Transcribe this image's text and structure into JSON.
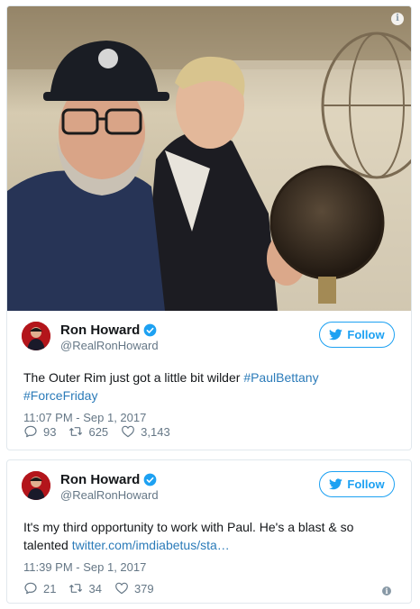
{
  "photo": {
    "info_glyph": "i"
  },
  "tweets": [
    {
      "author": {
        "name": "Ron Howard",
        "handle": "@RealRonHoward"
      },
      "follow_label": "Follow",
      "text_plain": "The Outer Rim just got a little bit wilder ",
      "hashtag_1": "#PaulBettany",
      "hashtag_2": "#ForceFriday",
      "timestamp": "11:07 PM - Sep 1, 2017",
      "replies": "93",
      "retweets": "625",
      "likes": "3,143"
    },
    {
      "author": {
        "name": "Ron Howard",
        "handle": "@RealRonHoward"
      },
      "follow_label": "Follow",
      "text_plain": "It's my third opportunity to work with Paul. He's a blast & so talented ",
      "link": "twitter.com/imdiabetus/sta…",
      "timestamp": "11:39 PM - Sep 1, 2017",
      "replies": "21",
      "retweets": "34",
      "likes": "379",
      "info_glyph": "i"
    }
  ],
  "colors": {
    "brand_blue": "#1da1f2",
    "link": "#2b7bb9",
    "muted": "#657786",
    "border": "#e1e8ed"
  },
  "icons": [
    "info-icon",
    "verified-badge-icon",
    "twitter-bird-icon",
    "reply-icon",
    "retweet-icon",
    "like-icon"
  ]
}
